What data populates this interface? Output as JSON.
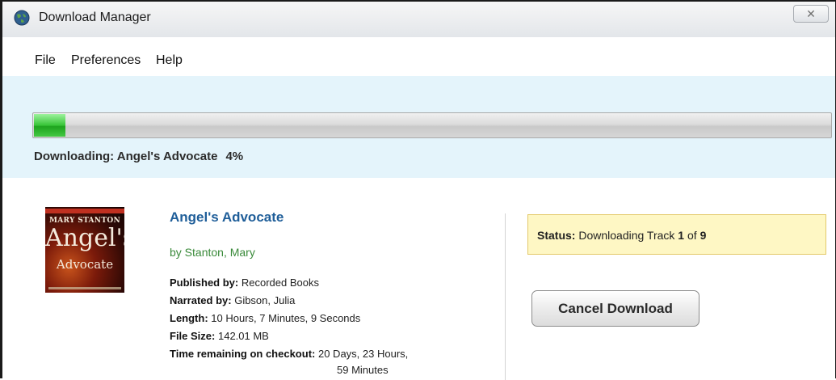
{
  "window": {
    "title": "Download Manager",
    "close_glyph": "✕"
  },
  "menu": [
    {
      "label": "File"
    },
    {
      "label": "Preferences"
    },
    {
      "label": "Help"
    }
  ],
  "progress": {
    "label_prefix": "Downloading: Angel's Advocate",
    "percent_text": "4%",
    "fraction": 0.04,
    "fill_color": "#37c437"
  },
  "book": {
    "cover_author": "MARY STANTON",
    "cover_title_1": "Angel's",
    "cover_title_2": "Advocate",
    "title": "Angel's Advocate",
    "author": "by Stanton, Mary",
    "published_label": "Published by:",
    "published_value": "Recorded Books",
    "narrated_label": "Narrated by:",
    "narrated_value": "Gibson, Julia",
    "length_label": "Length:",
    "length_value": "10 Hours, 7 Minutes, 9 Seconds",
    "filesize_label": "File Size:",
    "filesize_value": "142.01 MB",
    "time_label": "Time remaining on checkout:",
    "time_value_1": "20 Days, 23 Hours,",
    "time_value_2": "59 Minutes"
  },
  "status": {
    "label": "Status:",
    "text_prefix": "Downloading Track",
    "current": "1",
    "of": "of",
    "total": "9"
  },
  "actions": {
    "cancel_label": "Cancel Download"
  },
  "colors": {
    "title_link": "#1f5e99",
    "author_link": "#3a8a3a",
    "status_bg": "#fef7c4",
    "panel_bg": "#e4f4fb"
  }
}
